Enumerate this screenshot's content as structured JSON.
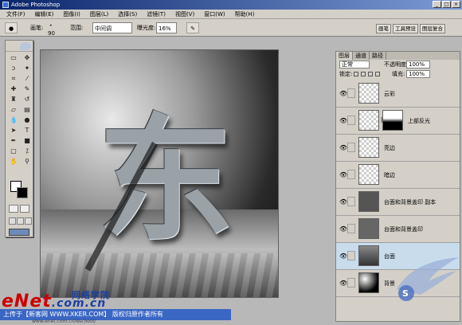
{
  "window": {
    "title": "Adobe Photoshop"
  },
  "menu": [
    "文件(F)",
    "编辑(E)",
    "图像(I)",
    "图层(L)",
    "选择(S)",
    "滤镜(T)",
    "视图(V)",
    "窗口(W)",
    "帮助(H)"
  ],
  "options": {
    "brush_label": "画笔:",
    "brush_size": "90",
    "range_label": "范围:",
    "range_value": "中间调",
    "exposure_label": "曝光度:",
    "exposure_value": "16%"
  },
  "panel_tabs": [
    "画笔",
    "工具预设",
    "图层复合"
  ],
  "layers_panel": {
    "tabs": [
      "图层",
      "通道",
      "路径"
    ],
    "blend_mode": "正常",
    "opacity_label": "不透明度:",
    "opacity_value": "100%",
    "lock_label": "锁定:",
    "fill_label": "填充:",
    "fill_value": "100%",
    "layers": [
      {
        "name": "云彩",
        "visible": true,
        "selected": false,
        "has_mask": false
      },
      {
        "name": "上部反光",
        "visible": true,
        "selected": false,
        "has_mask": true
      },
      {
        "name": "亮边",
        "visible": true,
        "selected": false,
        "has_mask": false
      },
      {
        "name": "暗边",
        "visible": true,
        "selected": false,
        "has_mask": false
      },
      {
        "name": "台面和背景盖印 副本",
        "visible": true,
        "selected": false,
        "has_mask": false
      },
      {
        "name": "台面和背景盖印",
        "visible": true,
        "selected": false,
        "has_mask": false
      },
      {
        "name": "台面",
        "visible": true,
        "selected": true,
        "has_mask": false
      },
      {
        "name": "背景",
        "visible": true,
        "selected": false,
        "has_mask": false
      }
    ]
  },
  "canvas": {
    "glyph": "东"
  },
  "watermark": {
    "brand": "eNet",
    "brand_suffix": ".com.cn",
    "school": "网络学院",
    "caption": "上传于【新客网 WWW.XKER.COM】 版权归原作者所有",
    "site": "www.enet.com.cn/eschool/"
  },
  "colors": {
    "titlebar": "#0a246a",
    "selected_layer": "#c8dcec",
    "caption_bg": "#3a66c4",
    "enet_red": "#cc0000"
  }
}
